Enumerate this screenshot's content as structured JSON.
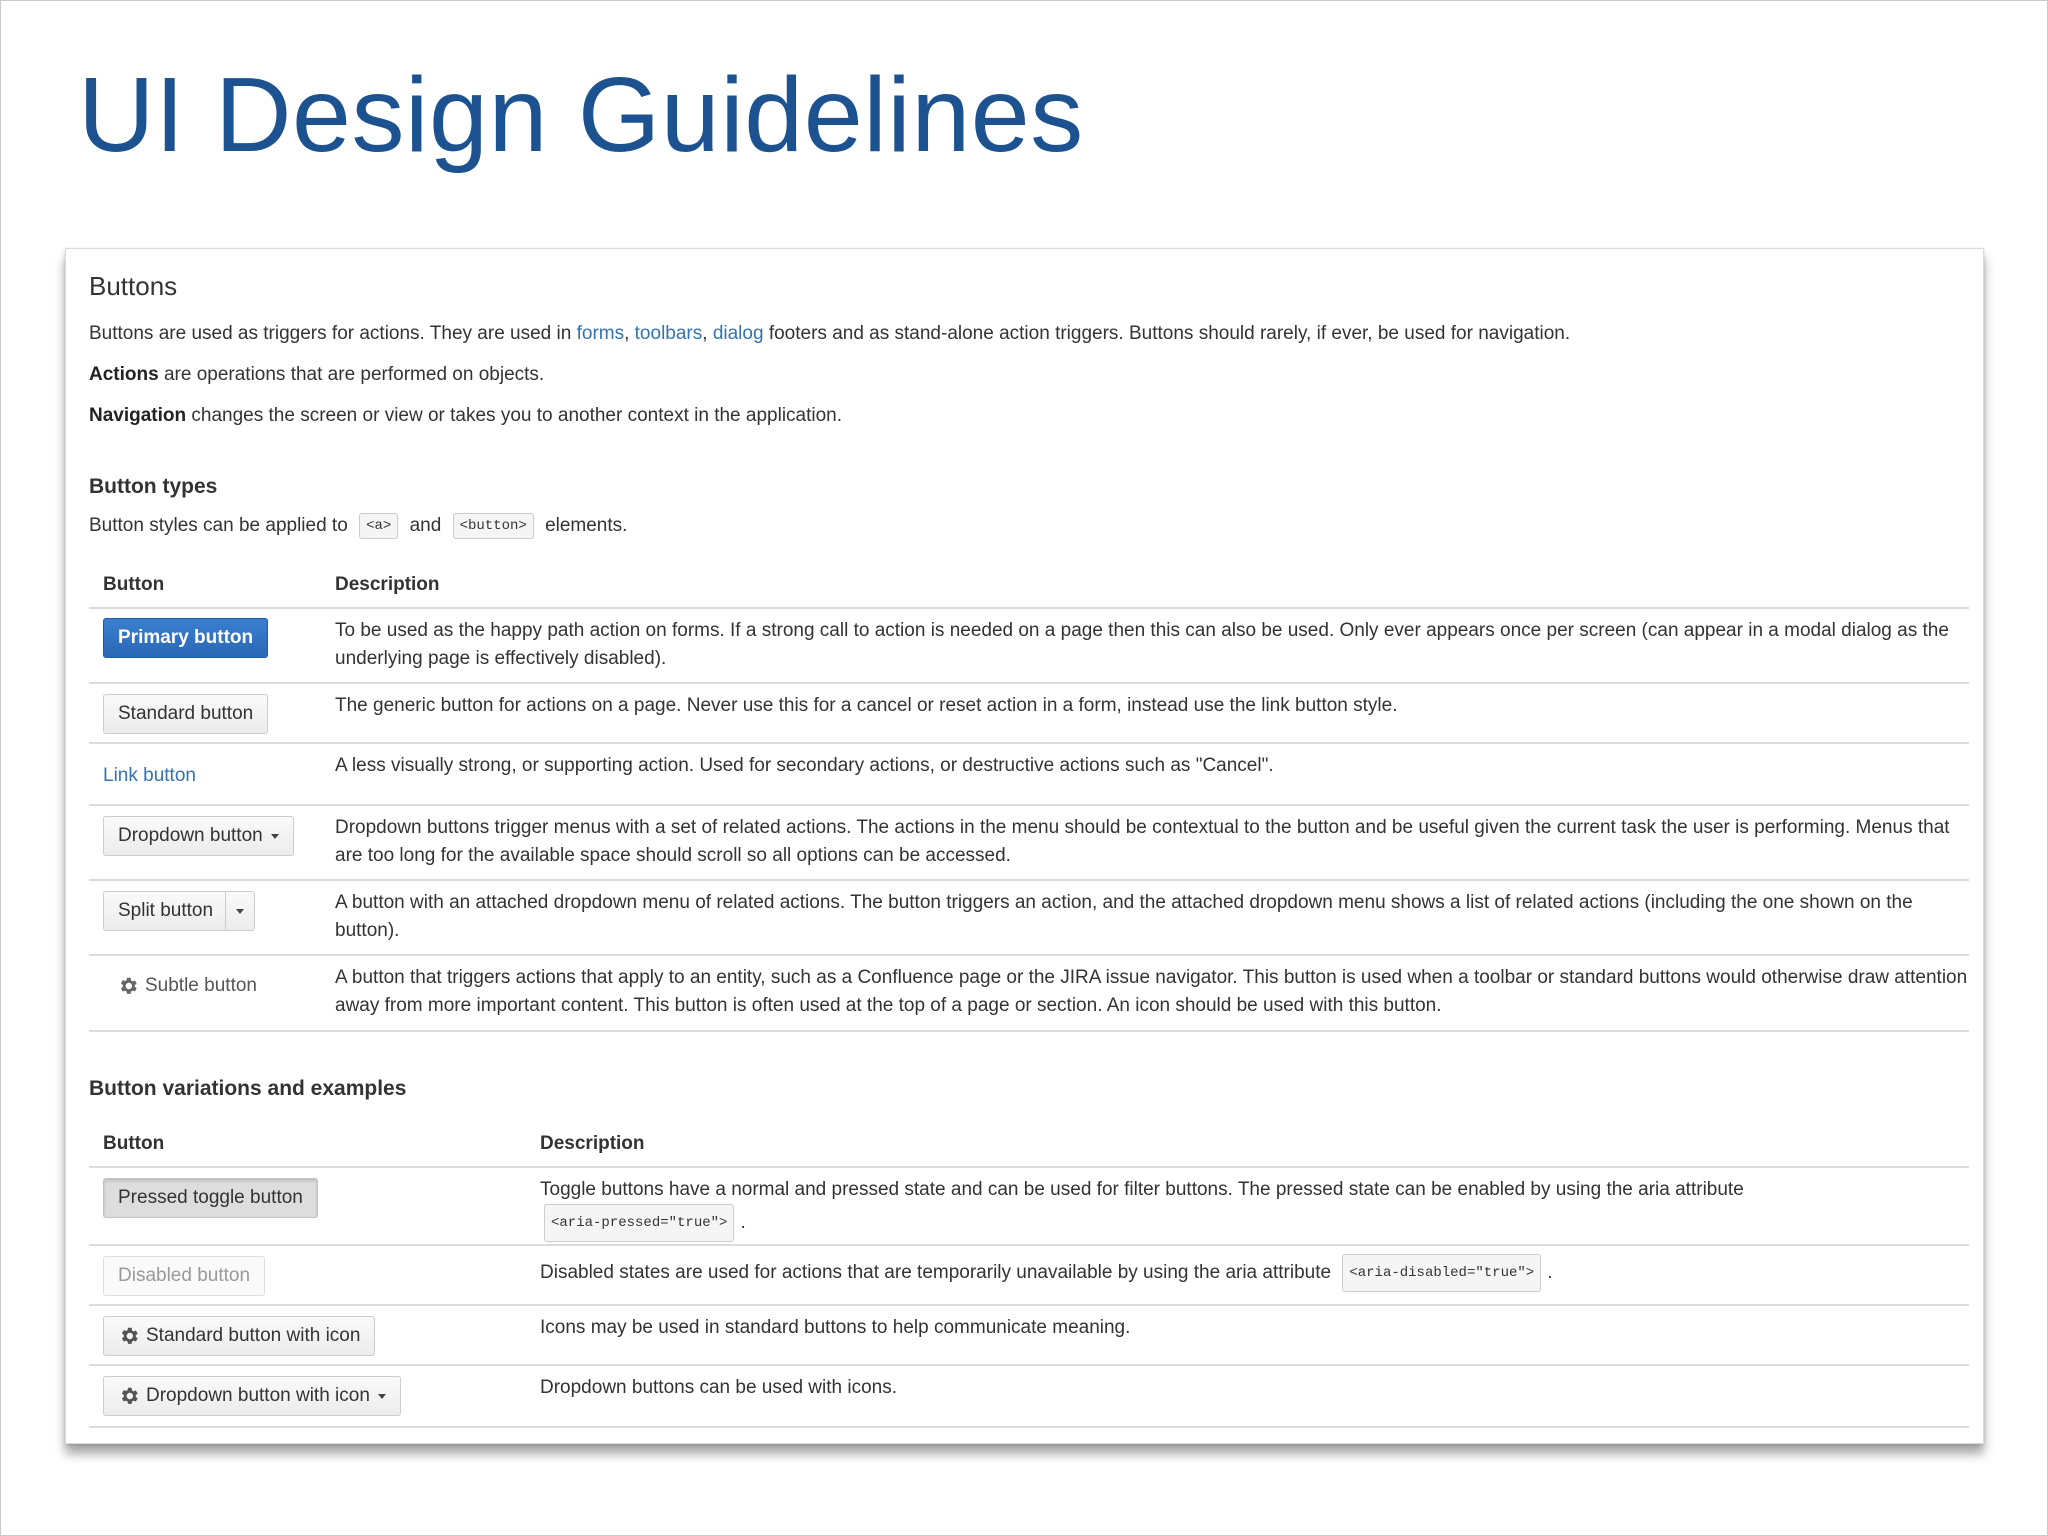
{
  "slide": {
    "title": "UI Design Guidelines"
  },
  "doc": {
    "heading": "Buttons",
    "intro": {
      "before": "Buttons are used as triggers for actions. They are used in ",
      "link_forms": "forms",
      "comma1": ", ",
      "link_toolbars": "toolbars",
      "comma2": ", ",
      "link_dialog": "dialog",
      "after": " footers and as stand-alone action triggers. Buttons should rarely, if ever, be used for navigation."
    },
    "actions": {
      "term": "Actions",
      "text": " are operations that are performed on objects."
    },
    "navigation": {
      "term": "Navigation",
      "text": " changes the screen or view or takes you to another context in the application."
    },
    "types": {
      "heading": "Button types",
      "applied_before": "Button styles can be applied to",
      "code_a": "<a>",
      "applied_and": "and",
      "code_button": "<button>",
      "applied_after": "elements.",
      "col_button": "Button",
      "col_description": "Description",
      "rows": [
        {
          "label": "Primary button",
          "desc": "To be used as the happy path action on forms. If a strong call to action is needed on a page then this can also be used. Only ever appears once per screen (can appear in a modal dialog as the underlying page is effectively disabled)."
        },
        {
          "label": "Standard button",
          "desc": "The generic button for actions on a page. Never use this for a cancel or reset action in a form, instead use the link button style."
        },
        {
          "label": "Link button",
          "desc": "A less visually strong, or supporting action. Used for secondary actions, or destructive actions such as \"Cancel\"."
        },
        {
          "label": "Dropdown button",
          "desc": "Dropdown buttons trigger menus with a set of related actions. The actions in the menu should be contextual to the button and be useful given the current task the user is performing. Menus that are too long for the available space should scroll so all options can be accessed."
        },
        {
          "label": "Split button",
          "desc": "A button with an attached dropdown menu of related actions. The button triggers an action, and the attached dropdown menu shows a list of related actions (including the one shown on the button)."
        },
        {
          "label": "Subtle button",
          "desc": "A button that triggers actions that apply to an entity, such as a Confluence page or the JIRA issue navigator. This button is used when a toolbar or standard buttons would otherwise draw attention away from more important content. This button is often used at the top of a page or section. An icon should be used with this button."
        }
      ]
    },
    "variations": {
      "heading": "Button variations and examples",
      "col_button": "Button",
      "col_description": "Description",
      "rows": [
        {
          "label": "Pressed toggle button",
          "desc": "Toggle buttons have a normal and pressed state and can be used for filter buttons. The pressed state can be enabled by using the aria attribute",
          "code": "<aria-pressed=\"true\">",
          "tail": "."
        },
        {
          "label": "Disabled button",
          "desc": "Disabled states are used for actions that are temporarily unavailable by using the aria attribute",
          "code": "<aria-disabled=\"true\">",
          "tail": "."
        },
        {
          "label": "Standard button with icon",
          "desc": "Icons may be used in standard buttons to help communicate meaning."
        },
        {
          "label": "Dropdown button with icon",
          "desc": "Dropdown buttons can be used with icons."
        }
      ]
    }
  },
  "colors": {
    "title": "#1c528f",
    "primary": "#2a67b5",
    "link": "#3572b0",
    "text": "#333333"
  }
}
